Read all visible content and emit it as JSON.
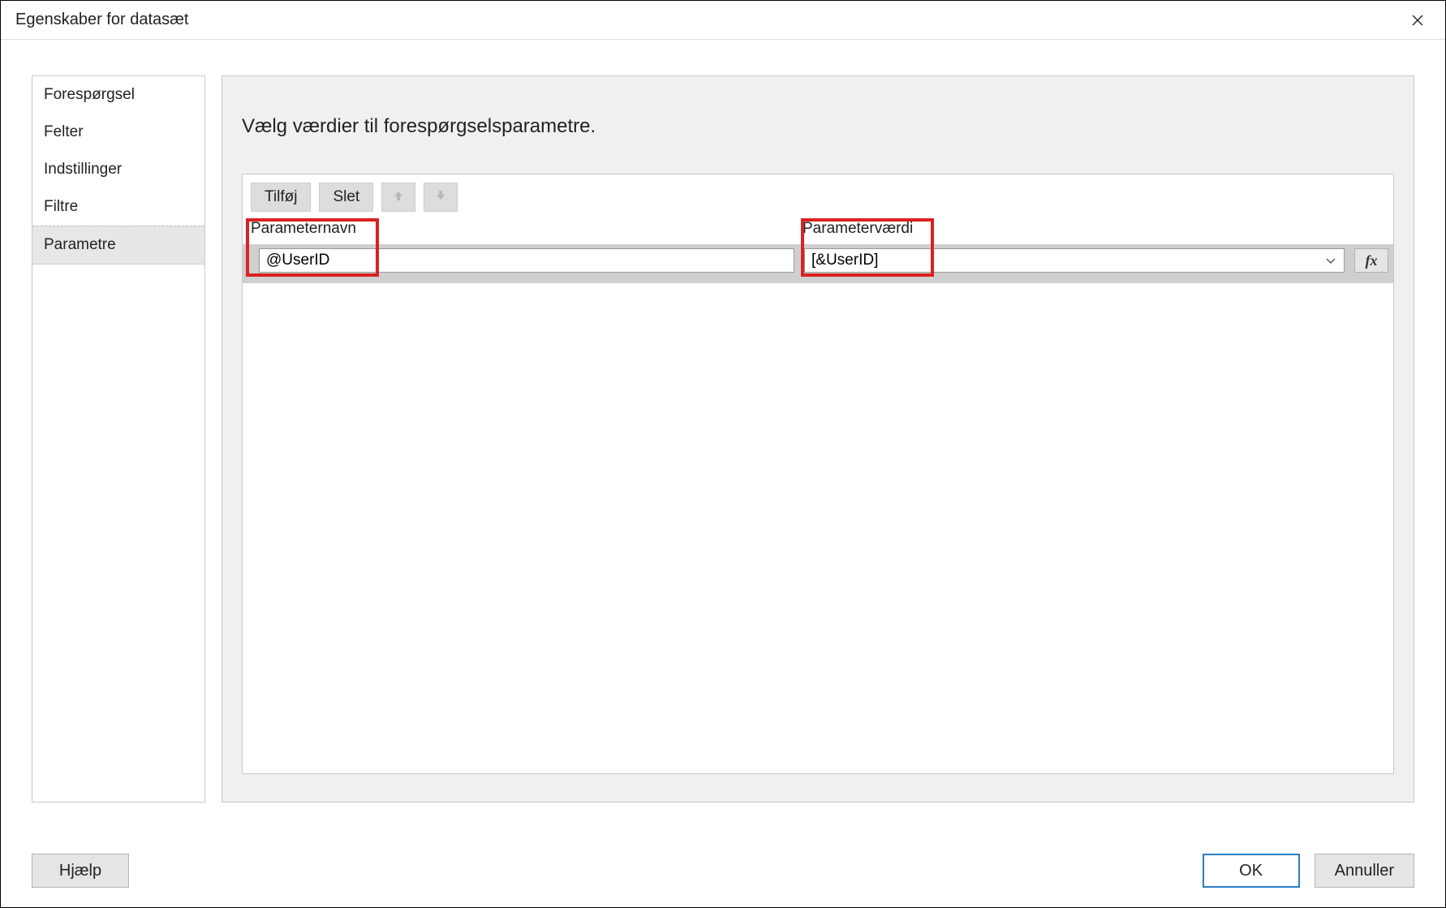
{
  "window": {
    "title": "Egenskaber for datasæt"
  },
  "sidebar": {
    "items": [
      {
        "label": "Forespørgsel"
      },
      {
        "label": "Felter"
      },
      {
        "label": "Indstillinger"
      },
      {
        "label": "Filtre"
      },
      {
        "label": "Parametre"
      }
    ],
    "selected_index": 4
  },
  "main": {
    "heading": "Vælg værdier til forespørgselsparametre.",
    "toolbar": {
      "add_label": "Tilføj",
      "delete_label": "Slet"
    },
    "columns": {
      "name_label": "Parameternavn",
      "value_label": "Parameterværdi"
    },
    "rows": [
      {
        "name": "@UserID",
        "value": "[&UserID]"
      }
    ],
    "fx_label": "fx"
  },
  "footer": {
    "help_label": "Hjælp",
    "ok_label": "OK",
    "cancel_label": "Annuller"
  }
}
